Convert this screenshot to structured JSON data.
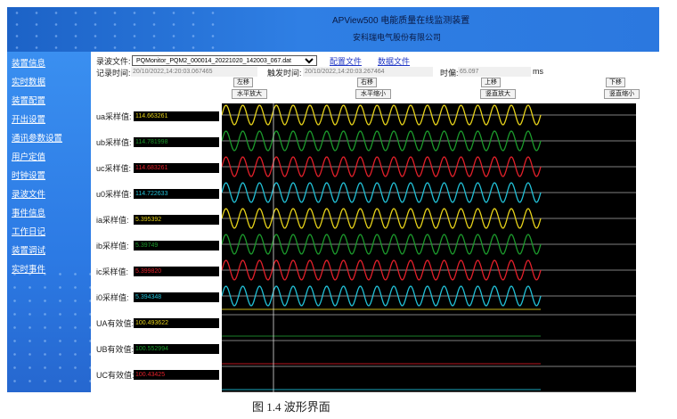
{
  "banner": {
    "title": "APView500 电能质量在线监测装置",
    "company": "安科瑞电气股份有限公司"
  },
  "sidebar": {
    "items": [
      "装置信息",
      "实时数据",
      "装置配置",
      "开出设置",
      "通讯参数设置",
      "用户定值",
      "时钟设置",
      "录波文件",
      "事件信息",
      "工作日记",
      "装置调试",
      "实时事件"
    ]
  },
  "toolbar": {
    "file_label": "录波文件:",
    "file_value": "PQMonitor_PQM2_000014_20221020_142003_067.dat",
    "config_link": "配置文件",
    "data_link": "数据文件",
    "record_label": "记录时间:",
    "record_value": "20/10/2022,14:20:03.067465",
    "trigger_label": "触发时间:",
    "trigger_value": "20/10/2022,14:20:03.267464",
    "offset_label": "时偏:",
    "offset_value": "65.097",
    "offset_unit": "ms"
  },
  "buttons": {
    "left": "左移",
    "right": "右移",
    "up": "上移",
    "down": "下移",
    "h_zoom_in": "水平放大",
    "h_zoom_out": "水平缩小",
    "v_zoom_in": "竖直放大",
    "v_zoom_out": "竖直缩小"
  },
  "channels": [
    {
      "label": "ua采样值:",
      "value": "114.663261",
      "color": "#e6d21a"
    },
    {
      "label": "ub采样值:",
      "value": "114.781998",
      "color": "#1c9a2c"
    },
    {
      "label": "uc采样值:",
      "value": "114.683261",
      "color": "#e2202a"
    },
    {
      "label": "u0采样值:",
      "value": "114.722633",
      "color": "#22c0d6"
    },
    {
      "label": "ia采样值:",
      "value": "5.395392",
      "color": "#e6d21a"
    },
    {
      "label": "ib采样值:",
      "value": "5.39749",
      "color": "#1c9a2c"
    },
    {
      "label": "ic采样值:",
      "value": "5.399820",
      "color": "#e2202a"
    },
    {
      "label": "i0采样值:",
      "value": "5.394348",
      "color": "#22c0d6"
    },
    {
      "label": "UA有效值:",
      "value": "100.493622",
      "color": "#e6d21a"
    },
    {
      "label": "UB有效值:",
      "value": "100.552994",
      "color": "#1c9a2c"
    },
    {
      "label": "UC有效值:",
      "value": "100.43425",
      "color": "#e2202a"
    }
  ],
  "caption": "图 1.4  波形界面"
}
